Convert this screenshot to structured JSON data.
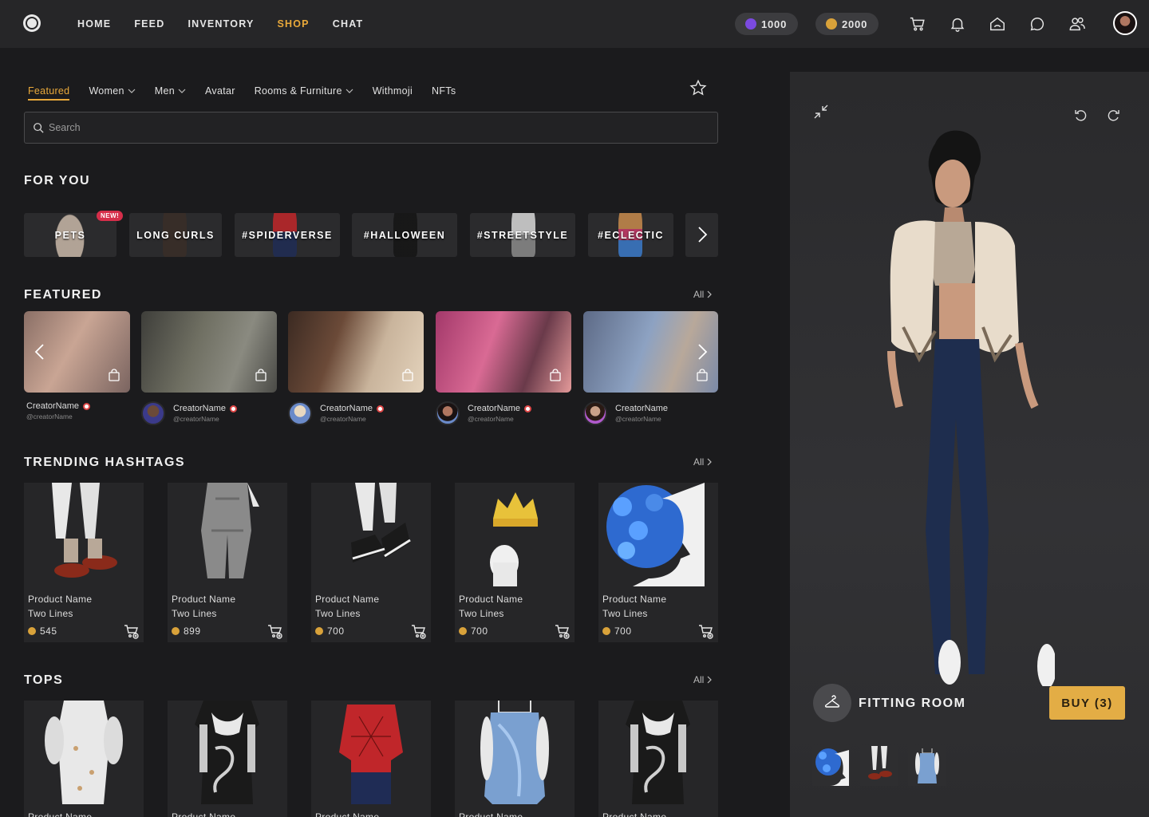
{
  "topnav": {
    "items": [
      "HOME",
      "FEED",
      "INVENTORY",
      "SHOP",
      "CHAT"
    ],
    "active": "SHOP",
    "credits_gems": "1000",
    "credits_coins": "2000"
  },
  "categories": {
    "items": [
      "Featured",
      "Women",
      "Men",
      "Avatar",
      "Rooms & Furniture",
      "Withmoji",
      "NFTs"
    ]
  },
  "search": {
    "placeholder": "Search"
  },
  "for_you": {
    "title": "FOR YOU",
    "new_badge": "NEW!",
    "chips": [
      "PETS",
      "LONG CURLS",
      "#SPIDERVERSE",
      "#HALLOWEEN",
      "#STREETSTYLE",
      "#ECLECTIC"
    ]
  },
  "featured": {
    "title": "FEATURED",
    "all": "All",
    "creators": [
      {
        "name": "CreatorName",
        "handle": "@creatorName"
      },
      {
        "name": "CreatorName",
        "handle": "@creatorName"
      },
      {
        "name": "CreatorName",
        "handle": "@creatorName"
      },
      {
        "name": "CreatorName",
        "handle": "@creatorName"
      },
      {
        "name": "CreatorName",
        "handle": "@creatorName"
      }
    ]
  },
  "trending": {
    "title": "TRENDING HASHTAGS",
    "all": "All",
    "products": [
      {
        "line1": "Product Name",
        "line2": "Two Lines",
        "price": "545"
      },
      {
        "line1": "Product Name",
        "line2": "Two Lines",
        "price": "899"
      },
      {
        "line1": "Product Name",
        "line2": "Two Lines",
        "price": "700"
      },
      {
        "line1": "Product Name",
        "line2": "Two Lines",
        "price": "700"
      },
      {
        "line1": "Product Name",
        "line2": "Two Lines",
        "price": "700"
      }
    ]
  },
  "tops": {
    "title": "TOPS",
    "all": "All",
    "products": [
      {
        "line1": "Product Name"
      },
      {
        "line1": "Product Name"
      },
      {
        "line1": "Product Name"
      },
      {
        "line1": "Product Name"
      },
      {
        "line1": "Product Name"
      }
    ]
  },
  "fitting_room": {
    "label": "FITTING ROOM",
    "buy": "BUY (3)"
  },
  "colors": {
    "accent": "#e8a83a",
    "buy": "#e3ad45",
    "coin": "#d9a23a",
    "gem": "#7b4ae0"
  },
  "icons": [
    "logo-icon",
    "gem-icon",
    "coin-icon",
    "cart-icon",
    "bell-icon",
    "home-icon",
    "chat-bubble-icon",
    "people-icon",
    "star-icon",
    "search-icon",
    "chevron-right-icon",
    "chevron-left-icon",
    "bag-icon",
    "add-to-cart-icon",
    "minimize-icon",
    "undo-icon",
    "redo-icon",
    "hanger-icon"
  ]
}
